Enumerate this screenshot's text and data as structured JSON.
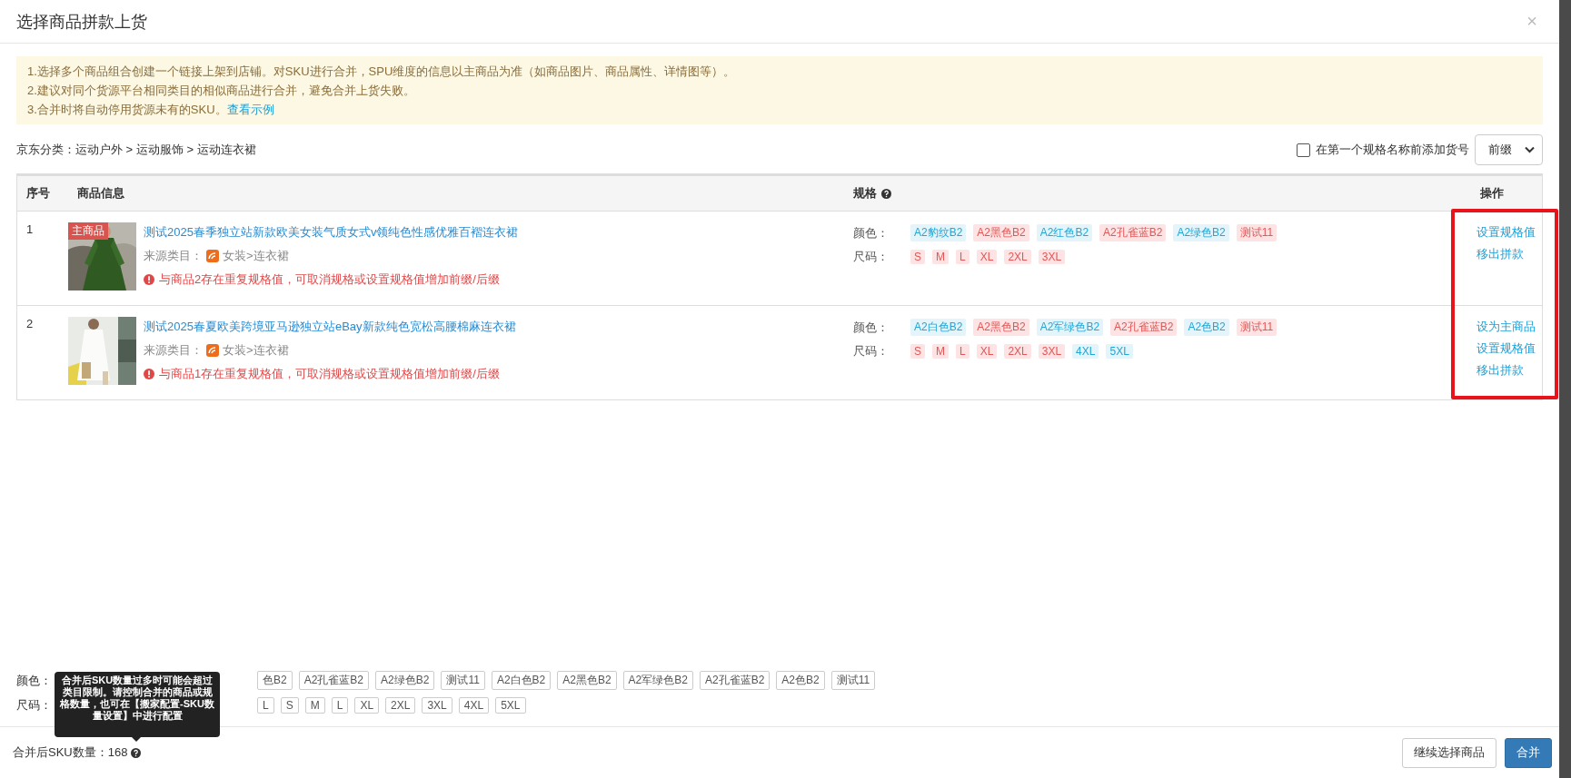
{
  "dialog": {
    "title": "选择商品拼款上货",
    "close": "×"
  },
  "notice": {
    "lines": [
      "1.选择多个商品组合创建一个链接上架到店铺。对SKU进行合并，SPU维度的信息以主商品为准（如商品图片、商品属性、详情图等）。",
      "2.建议对同个货源平台相同类目的相似商品进行合并，避免合并上货失败。"
    ],
    "last_line": {
      "text": "3.合并时将自动停用货源未有的SKU。",
      "link": "查看示例"
    }
  },
  "category": "京东分类：运动户外 > 运动服饰 > 运动连衣裙",
  "prefix_option": {
    "label": "在第一个规格名称前添加货号",
    "checked": false,
    "select": "前缀"
  },
  "table": {
    "columns": [
      {
        "label": "序号",
        "help": false
      },
      {
        "label": "商品信息",
        "help": false
      },
      {
        "label": "规格",
        "help": true
      },
      {
        "label": "操作",
        "help": false
      }
    ],
    "rows": [
      {
        "index": "1",
        "badge": "主商品",
        "title": "测试2025春季独立站新款欧美女装气质女式v领纯色性感优雅百褶连衣裙",
        "source_label": "来源类目：",
        "source": "女装>连衣裙",
        "warning": "与商品2存在重复规格值，可取消规格或设置规格值增加前缀/后缀",
        "specs": [
          {
            "name": "颜色：",
            "values": [
              {
                "text": "A2豹纹B2",
                "duplicate": false
              },
              {
                "text": "A2黑色B2",
                "duplicate": true
              },
              {
                "text": "A2红色B2",
                "duplicate": false
              },
              {
                "text": "A2孔雀蓝B2",
                "duplicate": true
              },
              {
                "text": "A2绿色B2",
                "duplicate": false
              },
              {
                "text": "测试11",
                "duplicate": true
              }
            ]
          },
          {
            "name": "尺码：",
            "values": [
              {
                "text": "S",
                "duplicate": true
              },
              {
                "text": "M",
                "duplicate": true
              },
              {
                "text": "L",
                "duplicate": true
              },
              {
                "text": "XL",
                "duplicate": true
              },
              {
                "text": "2XL",
                "duplicate": true
              },
              {
                "text": "3XL",
                "duplicate": true
              }
            ]
          }
        ],
        "actions": [
          "设置规格值",
          "移出拼款"
        ]
      },
      {
        "index": "2",
        "title": "测试2025春夏欧美跨境亚马逊独立站eBay新款纯色宽松高腰棉麻连衣裙",
        "source_label": "来源类目：",
        "source": "女装>连衣裙",
        "warning": "与商品1存在重复规格值，可取消规格或设置规格值增加前缀/后缀",
        "specs": [
          {
            "name": "颜色：",
            "values": [
              {
                "text": "A2白色B2",
                "duplicate": false
              },
              {
                "text": "A2黑色B2",
                "duplicate": true
              },
              {
                "text": "A2军绿色B2",
                "duplicate": false
              },
              {
                "text": "A2孔雀蓝B2",
                "duplicate": true
              },
              {
                "text": "A2色B2",
                "duplicate": false
              },
              {
                "text": "测试11",
                "duplicate": true
              }
            ]
          },
          {
            "name": "尺码：",
            "values": [
              {
                "text": "S",
                "duplicate": true
              },
              {
                "text": "M",
                "duplicate": true
              },
              {
                "text": "L",
                "duplicate": true
              },
              {
                "text": "XL",
                "duplicate": true
              },
              {
                "text": "2XL",
                "duplicate": true
              },
              {
                "text": "3XL",
                "duplicate": true
              },
              {
                "text": "4XL",
                "duplicate": false
              },
              {
                "text": "5XL",
                "duplicate": false
              }
            ]
          }
        ],
        "actions": [
          "设为主商品",
          "设置规格值",
          "移出拼款"
        ]
      }
    ]
  },
  "annotation": {
    "kind": "highlight"
  },
  "merged_specs": [
    {
      "name": "颜色：",
      "values": [
        "色B2",
        "A2孔雀蓝B2",
        "A2绿色B2",
        "测试11",
        "A2白色B2",
        "A2黑色B2",
        "A2军绿色B2",
        "A2孔雀蓝B2",
        "A2色B2",
        "测试11"
      ]
    },
    {
      "name": "尺码：",
      "values": [
        "L",
        "S",
        "M",
        "L",
        "XL",
        "2XL",
        "3XL",
        "4XL",
        "5XL"
      ]
    }
  ],
  "tooltip": "合并后SKU数量过多时可能会超过类目限制。请控制合并的商品或规格数量，也可在【搬家配置-SKU数量设置】中进行配置",
  "footer": {
    "sku_count": "合并后SKU数量：168"
  },
  "buttons": [
    {
      "label": "继续选择商品",
      "kind": "default"
    },
    {
      "label": "合并",
      "kind": "primary"
    }
  ]
}
